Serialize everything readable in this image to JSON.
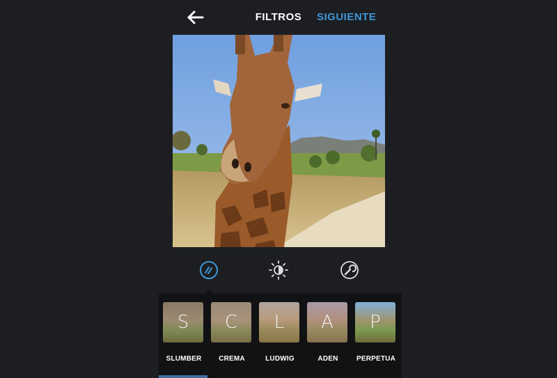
{
  "header": {
    "back_icon": "arrow-left-icon",
    "title": "FILTROS",
    "next_label": "SIGUIENTE",
    "next_color": "#3e97d9"
  },
  "tools": [
    {
      "icon": "filter-icon",
      "selected": true
    },
    {
      "icon": "brightness-icon",
      "selected": false
    },
    {
      "icon": "wrench-icon",
      "selected": false
    }
  ],
  "filters": [
    {
      "letter": "S",
      "label": "SLUMBER",
      "selected": true
    },
    {
      "letter": "C",
      "label": "CREMA",
      "selected": false
    },
    {
      "letter": "L",
      "label": "LUDWIG",
      "selected": false
    },
    {
      "letter": "A",
      "label": "ADEN",
      "selected": false
    },
    {
      "letter": "P",
      "label": "PERPETUA",
      "selected": false
    }
  ],
  "colors": {
    "background": "#1c1e21",
    "tray": "#111214",
    "accent": "#3e97d9"
  }
}
